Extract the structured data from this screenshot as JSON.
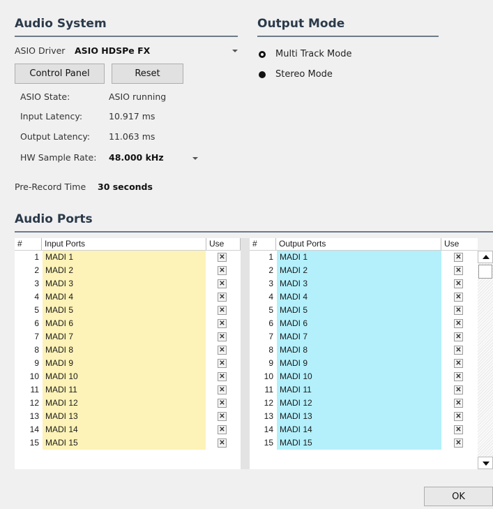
{
  "audio_system": {
    "title": "Audio System",
    "asio_driver_label": "ASIO Driver",
    "asio_driver_value": "ASIO HDSPe FX",
    "control_panel_label": "Control Panel",
    "reset_label": "Reset",
    "asio_state_label": "ASIO State:",
    "asio_state_value": "ASIO running",
    "input_latency_label": "Input Latency:",
    "input_latency_value": "10.917 ms",
    "output_latency_label": "Output Latency:",
    "output_latency_value": "11.063 ms",
    "hw_sample_rate_label": "HW Sample Rate:",
    "hw_sample_rate_value": "48.000 kHz",
    "pre_record_label": "Pre-Record Time",
    "pre_record_value": "30 seconds"
  },
  "output_mode": {
    "title": "Output Mode",
    "options": [
      {
        "label": "Multi Track Mode",
        "selected": false
      },
      {
        "label": "Stereo Mode",
        "selected": true
      }
    ]
  },
  "audio_ports": {
    "title": "Audio Ports",
    "input_headers": {
      "num": "#",
      "name": "Input Ports",
      "use": "Use"
    },
    "output_headers": {
      "num": "#",
      "name": "Output Ports",
      "use": "Use"
    },
    "use_mark": "✕",
    "inputs": [
      {
        "num": "1",
        "name": "MADI 1"
      },
      {
        "num": "2",
        "name": "MADI 2"
      },
      {
        "num": "3",
        "name": "MADI 3"
      },
      {
        "num": "4",
        "name": "MADI 4"
      },
      {
        "num": "5",
        "name": "MADI 5"
      },
      {
        "num": "6",
        "name": "MADI 6"
      },
      {
        "num": "7",
        "name": "MADI 7"
      },
      {
        "num": "8",
        "name": "MADI 8"
      },
      {
        "num": "9",
        "name": "MADI 9"
      },
      {
        "num": "10",
        "name": "MADI 10"
      },
      {
        "num": "11",
        "name": "MADI 11"
      },
      {
        "num": "12",
        "name": "MADI 12"
      },
      {
        "num": "13",
        "name": "MADI 13"
      },
      {
        "num": "14",
        "name": "MADI 14"
      },
      {
        "num": "15",
        "name": "MADI 15"
      }
    ],
    "outputs": [
      {
        "num": "1",
        "name": "MADI 1"
      },
      {
        "num": "2",
        "name": "MADI 2"
      },
      {
        "num": "3",
        "name": "MADI 3"
      },
      {
        "num": "4",
        "name": "MADI 4"
      },
      {
        "num": "5",
        "name": "MADI 5"
      },
      {
        "num": "6",
        "name": "MADI 6"
      },
      {
        "num": "7",
        "name": "MADI 7"
      },
      {
        "num": "8",
        "name": "MADI 8"
      },
      {
        "num": "9",
        "name": "MADI 9"
      },
      {
        "num": "10",
        "name": "MADI 10"
      },
      {
        "num": "11",
        "name": "MADI 11"
      },
      {
        "num": "12",
        "name": "MADI 12"
      },
      {
        "num": "13",
        "name": "MADI 13"
      },
      {
        "num": "14",
        "name": "MADI 14"
      },
      {
        "num": "15",
        "name": "MADI 15"
      }
    ]
  },
  "icons": {
    "dropdown": "chevron-down-icon",
    "scroll_up": "scroll-up-icon",
    "scroll_down": "scroll-down-icon"
  },
  "colors": {
    "input_port_bg": "#fdf2b7",
    "output_port_bg": "#b3f0fb",
    "section_title": "#2b3a4a"
  },
  "footer": {
    "ok_label": "OK"
  }
}
